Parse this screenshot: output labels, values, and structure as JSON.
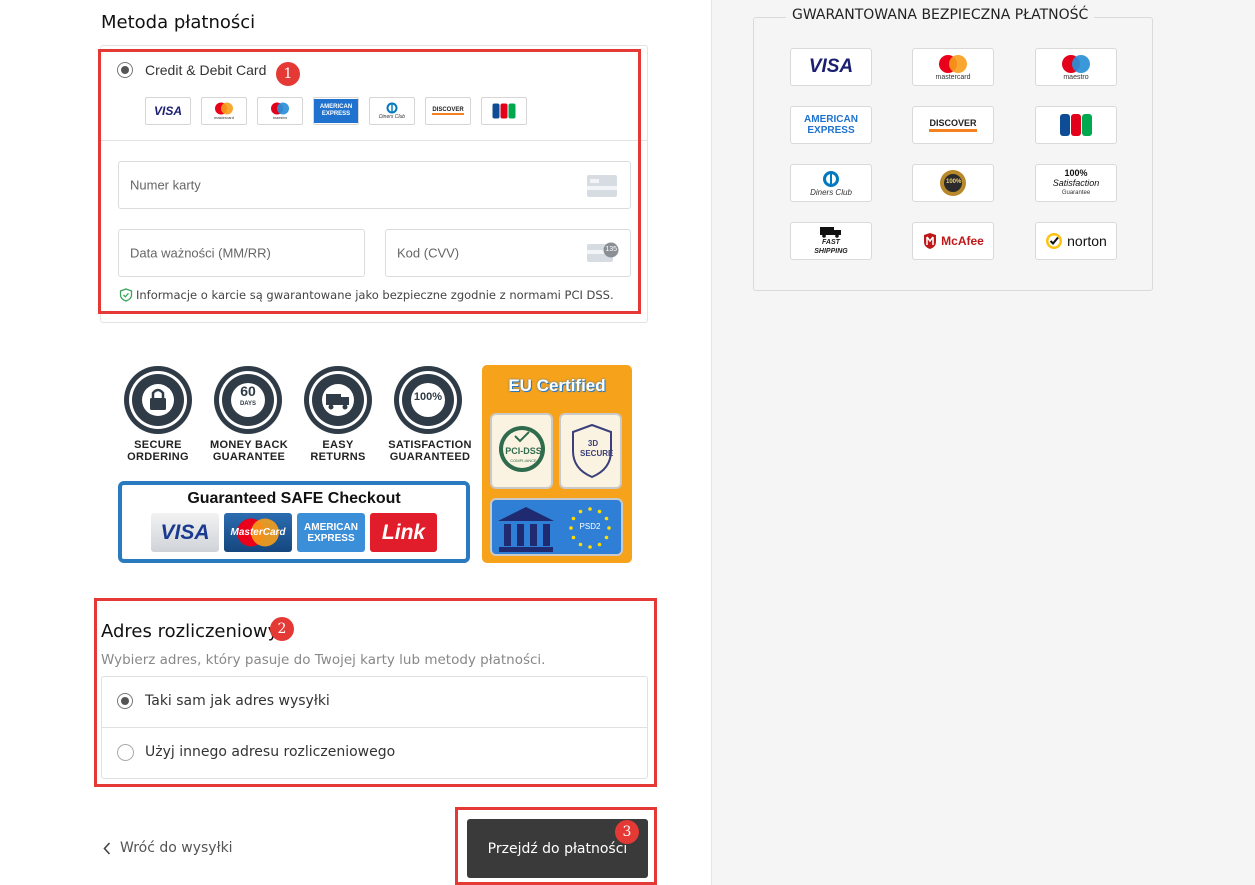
{
  "payment": {
    "title": "Metoda płatności",
    "method_label": "Credit & Debit Card",
    "card_number_placeholder": "Numer karty",
    "expiry_placeholder": "Data ważności (MM/RR)",
    "cvv_placeholder": "Kod (CVV)",
    "cvv_hint": "135",
    "pci_note": "Informacje o karcie są gwarantowane jako bezpieczne zgodnie z normami PCI DSS.",
    "card_brands": [
      {
        "name": "VISA"
      },
      {
        "name": "mastercard"
      },
      {
        "name": "maestro"
      },
      {
        "name": "AMERICAN EXPRESS"
      },
      {
        "name": "Diners Club"
      },
      {
        "name": "DISCOVER"
      },
      {
        "name": "JCB"
      }
    ]
  },
  "badges": {
    "items": [
      {
        "ring": "SECURE ORDERING",
        "l1": "SECURE",
        "l2": "ORDERING"
      },
      {
        "ring": "MONEY BACK",
        "center": "60",
        "sub": "DAYS",
        "l1": "MONEY BACK",
        "l2": "GUARANTEE"
      },
      {
        "ring": "EASY RETURNS",
        "l1": "EASY",
        "l2": "RETURNS"
      },
      {
        "ring": "SATISFACTION",
        "center": "100%",
        "l1": "SATISFACTION",
        "l2": "GUARANTEED"
      }
    ],
    "safe_checkout": {
      "title": "Guaranteed SAFE Checkout",
      "logos": [
        "VISA",
        "MasterCard",
        "AMERICAN EXPRESS",
        "Link"
      ]
    },
    "eu": {
      "title": "EU Certified",
      "pci": "PCI-DSS",
      "pci_sub": "COMPLIANCE",
      "secure": "3D SECURE",
      "psd2": "PSD2"
    }
  },
  "billing": {
    "title": "Adres rozliczeniowy",
    "subtitle": "Wybierz adres, który pasuje do Twojej karty lub metody płatności.",
    "option_same": "Taki sam jak adres wysyłki",
    "option_other": "Użyj innego adresu rozliczeniowego"
  },
  "footer": {
    "back_link": "Wróć do wysyłki",
    "continue_button": "Przejdź do płatności"
  },
  "annotations": [
    "1",
    "2",
    "3"
  ],
  "trust_panel": {
    "title": "GWARANTOWANA BEZPIECZNA PŁATNOŚĆ",
    "tiles": [
      {
        "label": "VISA"
      },
      {
        "label": "mastercard"
      },
      {
        "label": "maestro"
      },
      {
        "label": "AMERICAN EXPRESS"
      },
      {
        "label": "DISCOVER"
      },
      {
        "label": "JCB"
      },
      {
        "label": "Diners Club"
      },
      {
        "label": "100%"
      },
      {
        "label": "100% Satisfaction Guarantee",
        "l1": "100%",
        "l2": "Satisfaction",
        "l3": "Guarantee"
      },
      {
        "label": "FAST SHIPPING",
        "l1": "FAST",
        "l2": "SHIPPING"
      },
      {
        "label": "McAfee"
      },
      {
        "label": "norton"
      }
    ]
  },
  "colors": {
    "accent_red": "#e53935",
    "button_dark": "#3a3a3a",
    "badge_orange": "#f7a21b",
    "safe_blue": "#2a7ac0"
  }
}
